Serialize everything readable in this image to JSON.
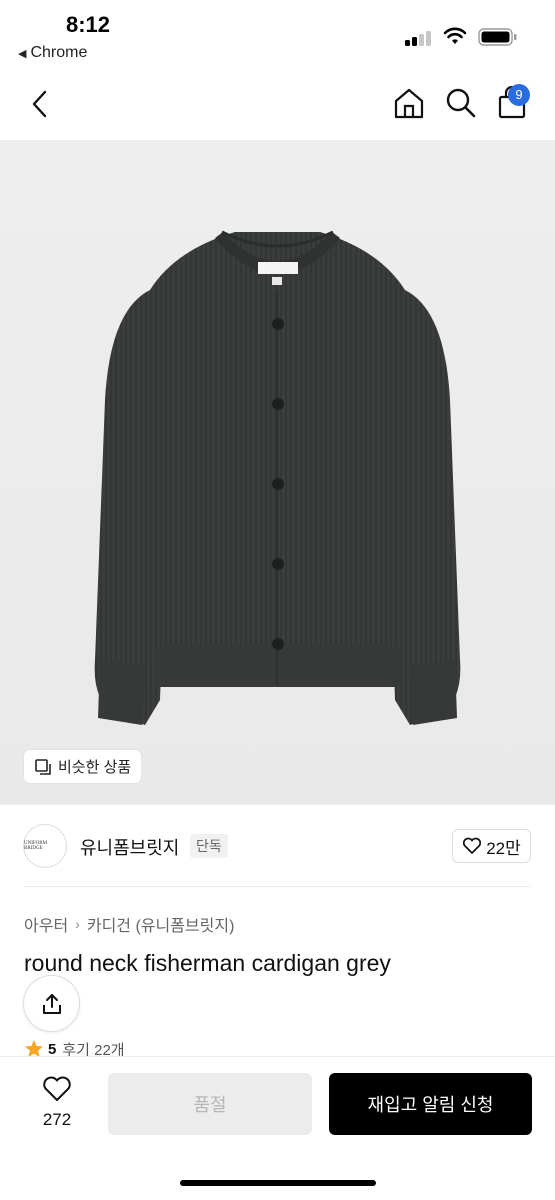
{
  "status_bar": {
    "time": "8:12",
    "back_app": "Chrome",
    "back_app_arrow": "◀"
  },
  "nav": {
    "cart_count": "9",
    "icons": [
      "chevron-left-icon",
      "home-icon",
      "search-icon",
      "shopping-bag-icon"
    ]
  },
  "product_image": {
    "similar_label": "비슷한 상품"
  },
  "brand": {
    "name": "유니폼브릿지",
    "tag": "단독",
    "likes": "22만"
  },
  "breadcrumb": {
    "items": [
      "아우터",
      "카디건 (유니폼브릿지)"
    ],
    "separator": "›"
  },
  "product": {
    "title": "round neck fisherman cardigan grey",
    "rating_score": "5",
    "review_label": "후기 22개"
  },
  "bottom_bar": {
    "wish_count": "272",
    "soldout_label": "품절",
    "restock_label": "재입고 알림 신청"
  },
  "colors": {
    "accent_badge": "#2b6be0",
    "primary_button": "#000000",
    "disabled_button": "#ececec",
    "star": "#f5a623"
  }
}
